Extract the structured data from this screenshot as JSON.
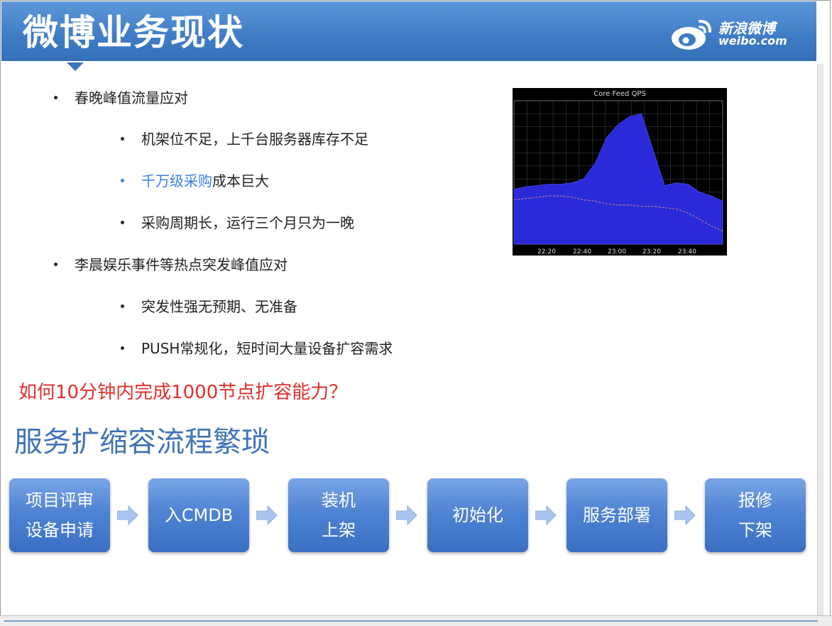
{
  "header": {
    "title": "微博业务现状",
    "logo_cn": "新浪微博",
    "logo_en": "weibo.com"
  },
  "bullets": [
    {
      "level": 1,
      "text": "春晚峰值流量应对"
    },
    {
      "level": 2,
      "text": "机架位不足，上千台服务器库存不足"
    },
    {
      "level": 2,
      "highlight": "千万级采购",
      "rest": "成本巨大"
    },
    {
      "level": 2,
      "text": "采购周期长，运行三个月只为一晚"
    },
    {
      "level": 1,
      "text": "李晨娱乐事件等热点突发峰值应对"
    },
    {
      "level": 2,
      "text": "突发性强无预期、无准备"
    },
    {
      "level": 2,
      "text": "PUSH常规化，短时间大量设备扩容需求"
    }
  ],
  "question": "如何10分钟内完成1000节点扩容能力？",
  "section_title": "服务扩缩容流程繁琐",
  "steps": [
    {
      "line1": "项目评审",
      "line2": "设备申请"
    },
    {
      "line1": "入CMDB",
      "line2": ""
    },
    {
      "line1": "装机",
      "line2": "上架"
    },
    {
      "line1": "初始化",
      "line2": ""
    },
    {
      "line1": "服务部署",
      "line2": ""
    },
    {
      "line1": "报修",
      "line2": "下架"
    }
  ],
  "chart_data": {
    "type": "area",
    "title": "Core Feed QPS",
    "tick_labels": [
      "22:20",
      "22:40",
      "23:00",
      "23:20",
      "23:40"
    ],
    "x": [
      "22:00",
      "22:10",
      "22:20",
      "22:30",
      "22:40",
      "22:50",
      "23:00",
      "23:05",
      "23:10",
      "23:15",
      "23:17",
      "23:19",
      "23:20",
      "23:22",
      "23:25",
      "23:30",
      "23:40",
      "23:50",
      "24:00"
    ],
    "series": [
      {
        "values": [
          0.42,
          0.44,
          0.45,
          0.46,
          0.46,
          0.47,
          0.5,
          0.62,
          0.82,
          0.92,
          0.98,
          1.0,
          0.72,
          0.45,
          0.47,
          0.46,
          0.4,
          0.37,
          0.33
        ]
      },
      {
        "values": [
          0.34,
          0.35,
          0.36,
          0.37,
          0.37,
          0.36,
          0.34,
          0.33,
          0.31,
          0.3,
          0.3,
          0.29,
          0.29,
          0.28,
          0.27,
          0.24,
          0.19,
          0.14,
          0.1
        ]
      }
    ],
    "ylim": [
      0,
      1.1
    ],
    "grid": true,
    "colors": {
      "area": "#2a2ad8",
      "background": "#000000",
      "grid": "#5a5a5a",
      "baseline": "#d98a8a"
    }
  }
}
